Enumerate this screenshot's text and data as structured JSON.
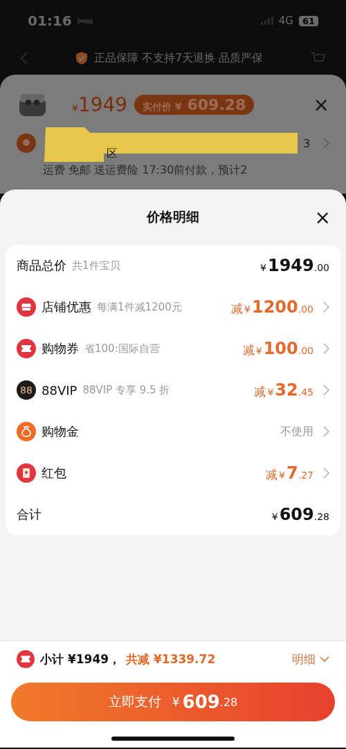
{
  "status_bar": {
    "time": "01:16",
    "network": "4G",
    "battery": "61"
  },
  "guarantee_banner": {
    "text": "正品保障 不支持7天退换 品质严保"
  },
  "product_card": {
    "price_symbol": "¥",
    "price": "1949",
    "paid_label": "实付价 ¥",
    "paid_price": "609.28",
    "address_tail": "区",
    "address_end": "3",
    "shipping": "运费 免邮  送运费险  17:30前付款，预计2"
  },
  "sheet": {
    "title": "价格明细",
    "close": "×"
  },
  "rows": [
    {
      "kind": "plain",
      "label": "商品总价",
      "note": "共1件宝贝",
      "prefix": "",
      "symbol": "¥",
      "int": "1949",
      "dec": ".00",
      "chevron": false
    },
    {
      "kind": "shop",
      "label": "店铺优惠",
      "note": "每满1件减1200元",
      "prefix": "减",
      "symbol": "¥",
      "int": "1200",
      "dec": ".00",
      "chevron": true
    },
    {
      "kind": "coupon",
      "label": "购物券",
      "note": "省100:国际自营",
      "prefix": "减",
      "symbol": "¥",
      "int": "100",
      "dec": ".00",
      "chevron": true
    },
    {
      "kind": "vip",
      "icon_text": "88",
      "label": "88VIP",
      "note": "88VIP 专享 9.5 折",
      "prefix": "减",
      "symbol": "¥",
      "int": "32",
      "dec": ".45",
      "chevron": true
    },
    {
      "kind": "gold",
      "label": "购物金",
      "value_text": "不使用",
      "chevron": true
    },
    {
      "kind": "packet",
      "label": "红包",
      "prefix": "减",
      "symbol": "¥",
      "int": "7",
      "dec": ".27",
      "chevron": true
    },
    {
      "kind": "plain",
      "label": "合计",
      "prefix": "",
      "symbol": "¥",
      "int": "609",
      "dec": ".28",
      "chevron": false
    }
  ],
  "footer": {
    "subtotal": "小计 ¥1949，",
    "saved": "共减 ¥1339.72",
    "detail": "明细",
    "pay_label": "立即支付",
    "pay_symbol": "¥",
    "pay_int": "609",
    "pay_dec": ".28"
  }
}
